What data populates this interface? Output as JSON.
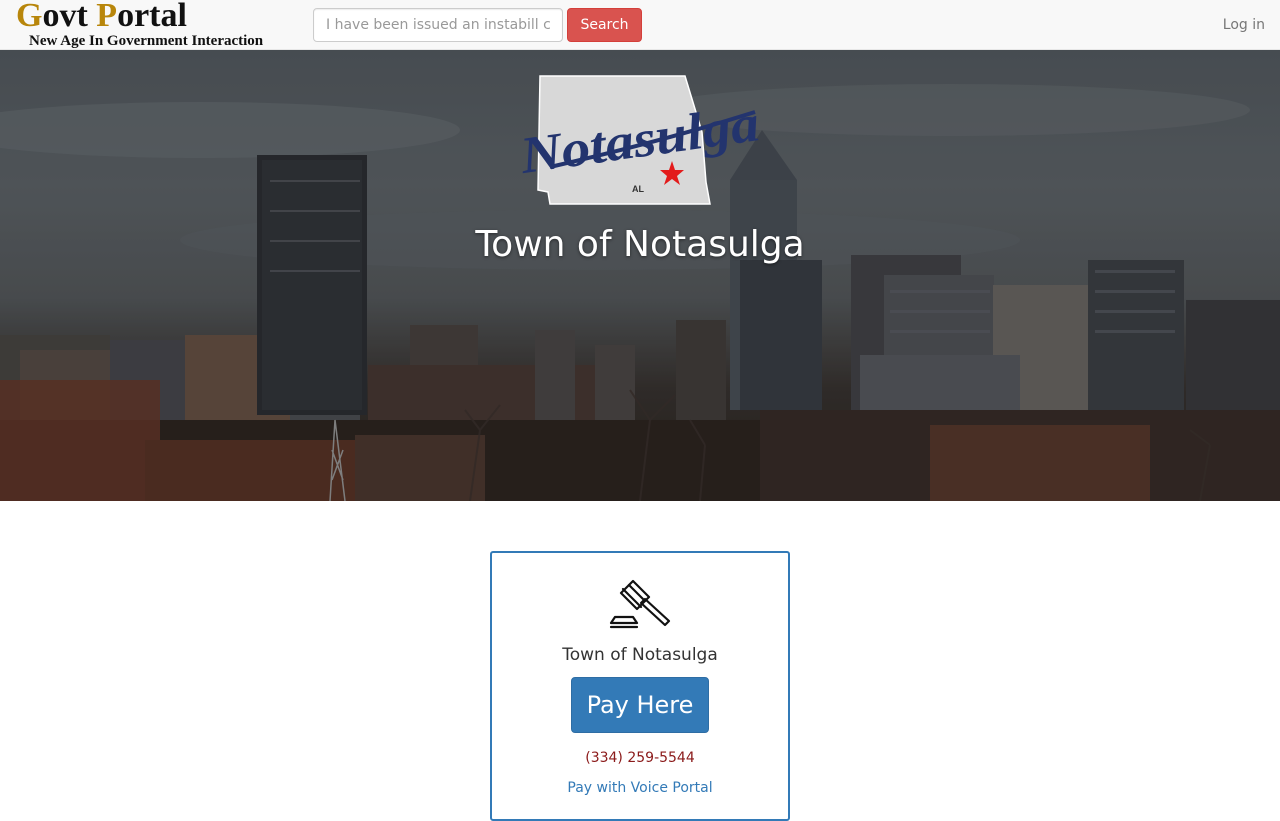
{
  "brand": {
    "govt_first": "G",
    "govt_rest": "ovt ",
    "portal_first": "P",
    "portal_rest": "ortal",
    "tagline": "New Age In Government Interaction"
  },
  "search": {
    "placeholder": "I have been issued an instabill c",
    "button_label": "Search"
  },
  "nav": {
    "login_label": "Log in"
  },
  "hero": {
    "title": "Town of Notasulga",
    "logo_script": "Notasulga",
    "logo_state": "AL"
  },
  "card": {
    "icon": "gavel-icon",
    "title": "Town of Notasulga",
    "pay_button_label": "Pay Here",
    "phone": "(334) 259-5544",
    "voice_link_label": "Pay with Voice Portal"
  },
  "colors": {
    "brand_gold": "#b8860b",
    "search_button": "#d9534f",
    "primary": "#337ab7",
    "phone_text": "#8b1a1a"
  }
}
